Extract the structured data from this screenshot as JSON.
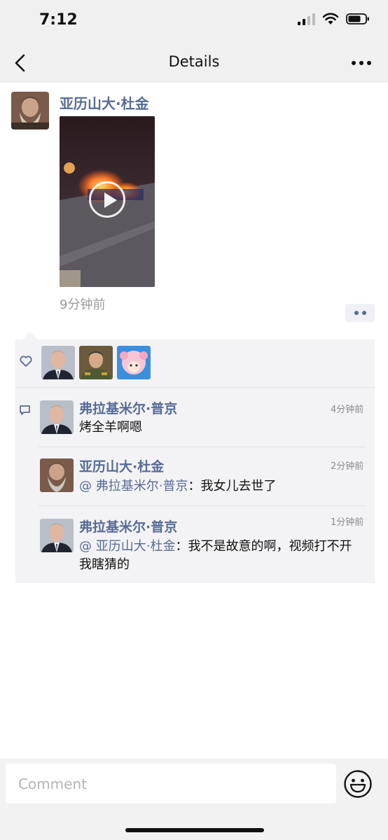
{
  "status_bar": {
    "time": "7:12"
  },
  "nav": {
    "title": "Details"
  },
  "post": {
    "author": "亚历山大·杜金",
    "time": "9分钟前"
  },
  "likes": {
    "users": [
      "putin",
      "shoigu",
      "anime-character"
    ]
  },
  "comments": [
    {
      "name": "弗拉基米尔·普京",
      "time": "4分钟前",
      "mention": "",
      "text": "烤全羊啊嗯"
    },
    {
      "name": "亚历山大·杜金",
      "time": "2分钟前",
      "mention": "@ 弗拉基米尔·普京",
      "text": "：我女儿去世了"
    },
    {
      "name": "弗拉基米尔·普京",
      "time": "1分钟前",
      "mention": "@ 亚历山大·杜金",
      "text": "：我不是故意的啊，视频打不开我瞎猜的"
    }
  ],
  "input": {
    "placeholder": "Comment"
  },
  "colors": {
    "link": "#576b95",
    "bar": "#f0f0f0",
    "panel": "#f3f3f5"
  }
}
